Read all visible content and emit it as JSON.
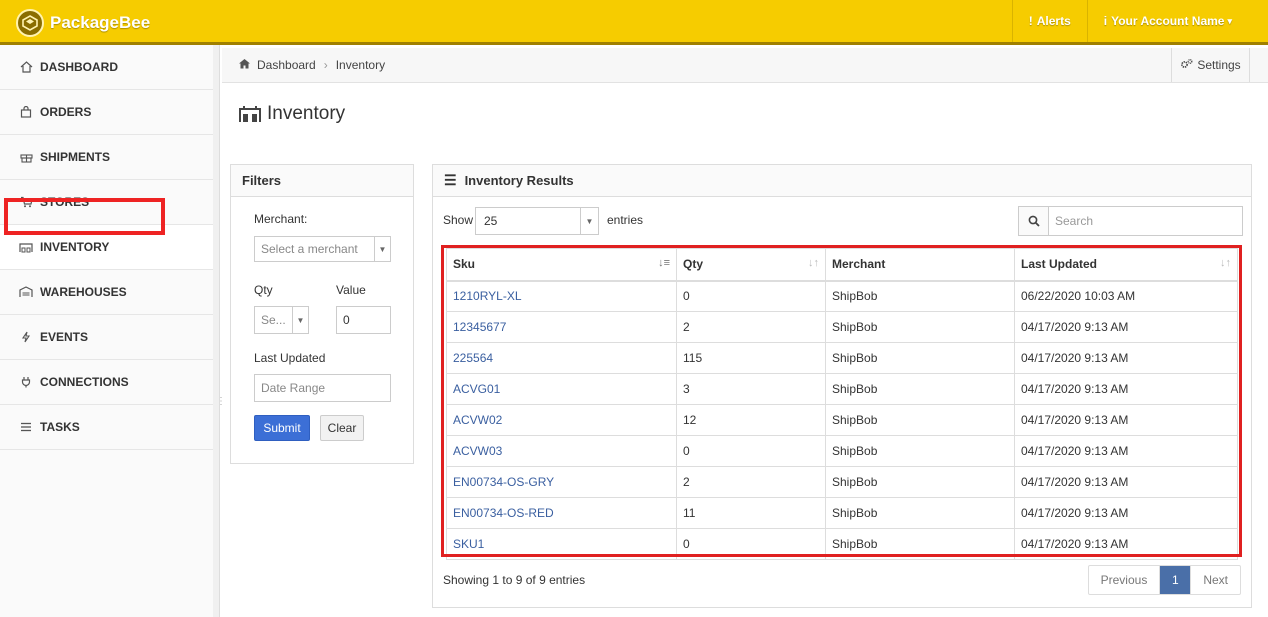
{
  "header": {
    "brand": "PackageBee",
    "alerts_label": "Alerts",
    "account_label": "Your Account Name"
  },
  "sidebar": {
    "items": [
      {
        "label": "DASHBOARD",
        "icon": "home-icon"
      },
      {
        "label": "ORDERS",
        "icon": "bag-icon"
      },
      {
        "label": "SHIPMENTS",
        "icon": "gift-icon"
      },
      {
        "label": "STORES",
        "icon": "cart-icon"
      },
      {
        "label": "INVENTORY",
        "icon": "warehouse-icon",
        "active": true
      },
      {
        "label": "WAREHOUSES",
        "icon": "warehouse-building-icon"
      },
      {
        "label": "EVENTS",
        "icon": "bolt-icon"
      },
      {
        "label": "CONNECTIONS",
        "icon": "plug-icon"
      },
      {
        "label": "TASKS",
        "icon": "list-icon"
      }
    ]
  },
  "breadcrumb": {
    "items": [
      "Dashboard",
      "Inventory"
    ],
    "settings_label": "Settings"
  },
  "page": {
    "title": "Inventory"
  },
  "filters": {
    "title": "Filters",
    "merchant_label": "Merchant:",
    "merchant_placeholder": "Select a merchant",
    "qty_label": "Qty",
    "qty_select": "Se...",
    "value_label": "Value",
    "value_input": "0",
    "last_updated_label": "Last Updated",
    "date_placeholder": "Date Range",
    "submit_label": "Submit",
    "clear_label": "Clear"
  },
  "results": {
    "title": "Inventory Results",
    "show_label": "Show",
    "entries_value": "25",
    "entries_label": "entries",
    "search_placeholder": "Search",
    "columns": [
      "Sku",
      "Qty",
      "Merchant",
      "Last Updated"
    ],
    "rows": [
      [
        "1210RYL-XL",
        "0",
        "ShipBob",
        "06/22/2020 10:03 AM"
      ],
      [
        "12345677",
        "2",
        "ShipBob",
        "04/17/2020 9:13 AM"
      ],
      [
        "225564",
        "115",
        "ShipBob",
        "04/17/2020 9:13 AM"
      ],
      [
        "ACVG01",
        "3",
        "ShipBob",
        "04/17/2020 9:13 AM"
      ],
      [
        "ACVW02",
        "12",
        "ShipBob",
        "04/17/2020 9:13 AM"
      ],
      [
        "ACVW03",
        "0",
        "ShipBob",
        "04/17/2020 9:13 AM"
      ],
      [
        "EN00734-OS-GRY",
        "2",
        "ShipBob",
        "04/17/2020 9:13 AM"
      ],
      [
        "EN00734-OS-RED",
        "11",
        "ShipBob",
        "04/17/2020 9:13 AM"
      ],
      [
        "SKU1",
        "0",
        "ShipBob",
        "04/17/2020 9:13 AM"
      ]
    ],
    "info": "Showing 1 to 9 of 9 entries",
    "pager": {
      "prev": "Previous",
      "current": "1",
      "next": "Next"
    }
  },
  "colors": {
    "topbar": "#f6cc00",
    "primary": "#3c6fd6",
    "highlight": "#e02020",
    "link": "#3a5fa0"
  }
}
